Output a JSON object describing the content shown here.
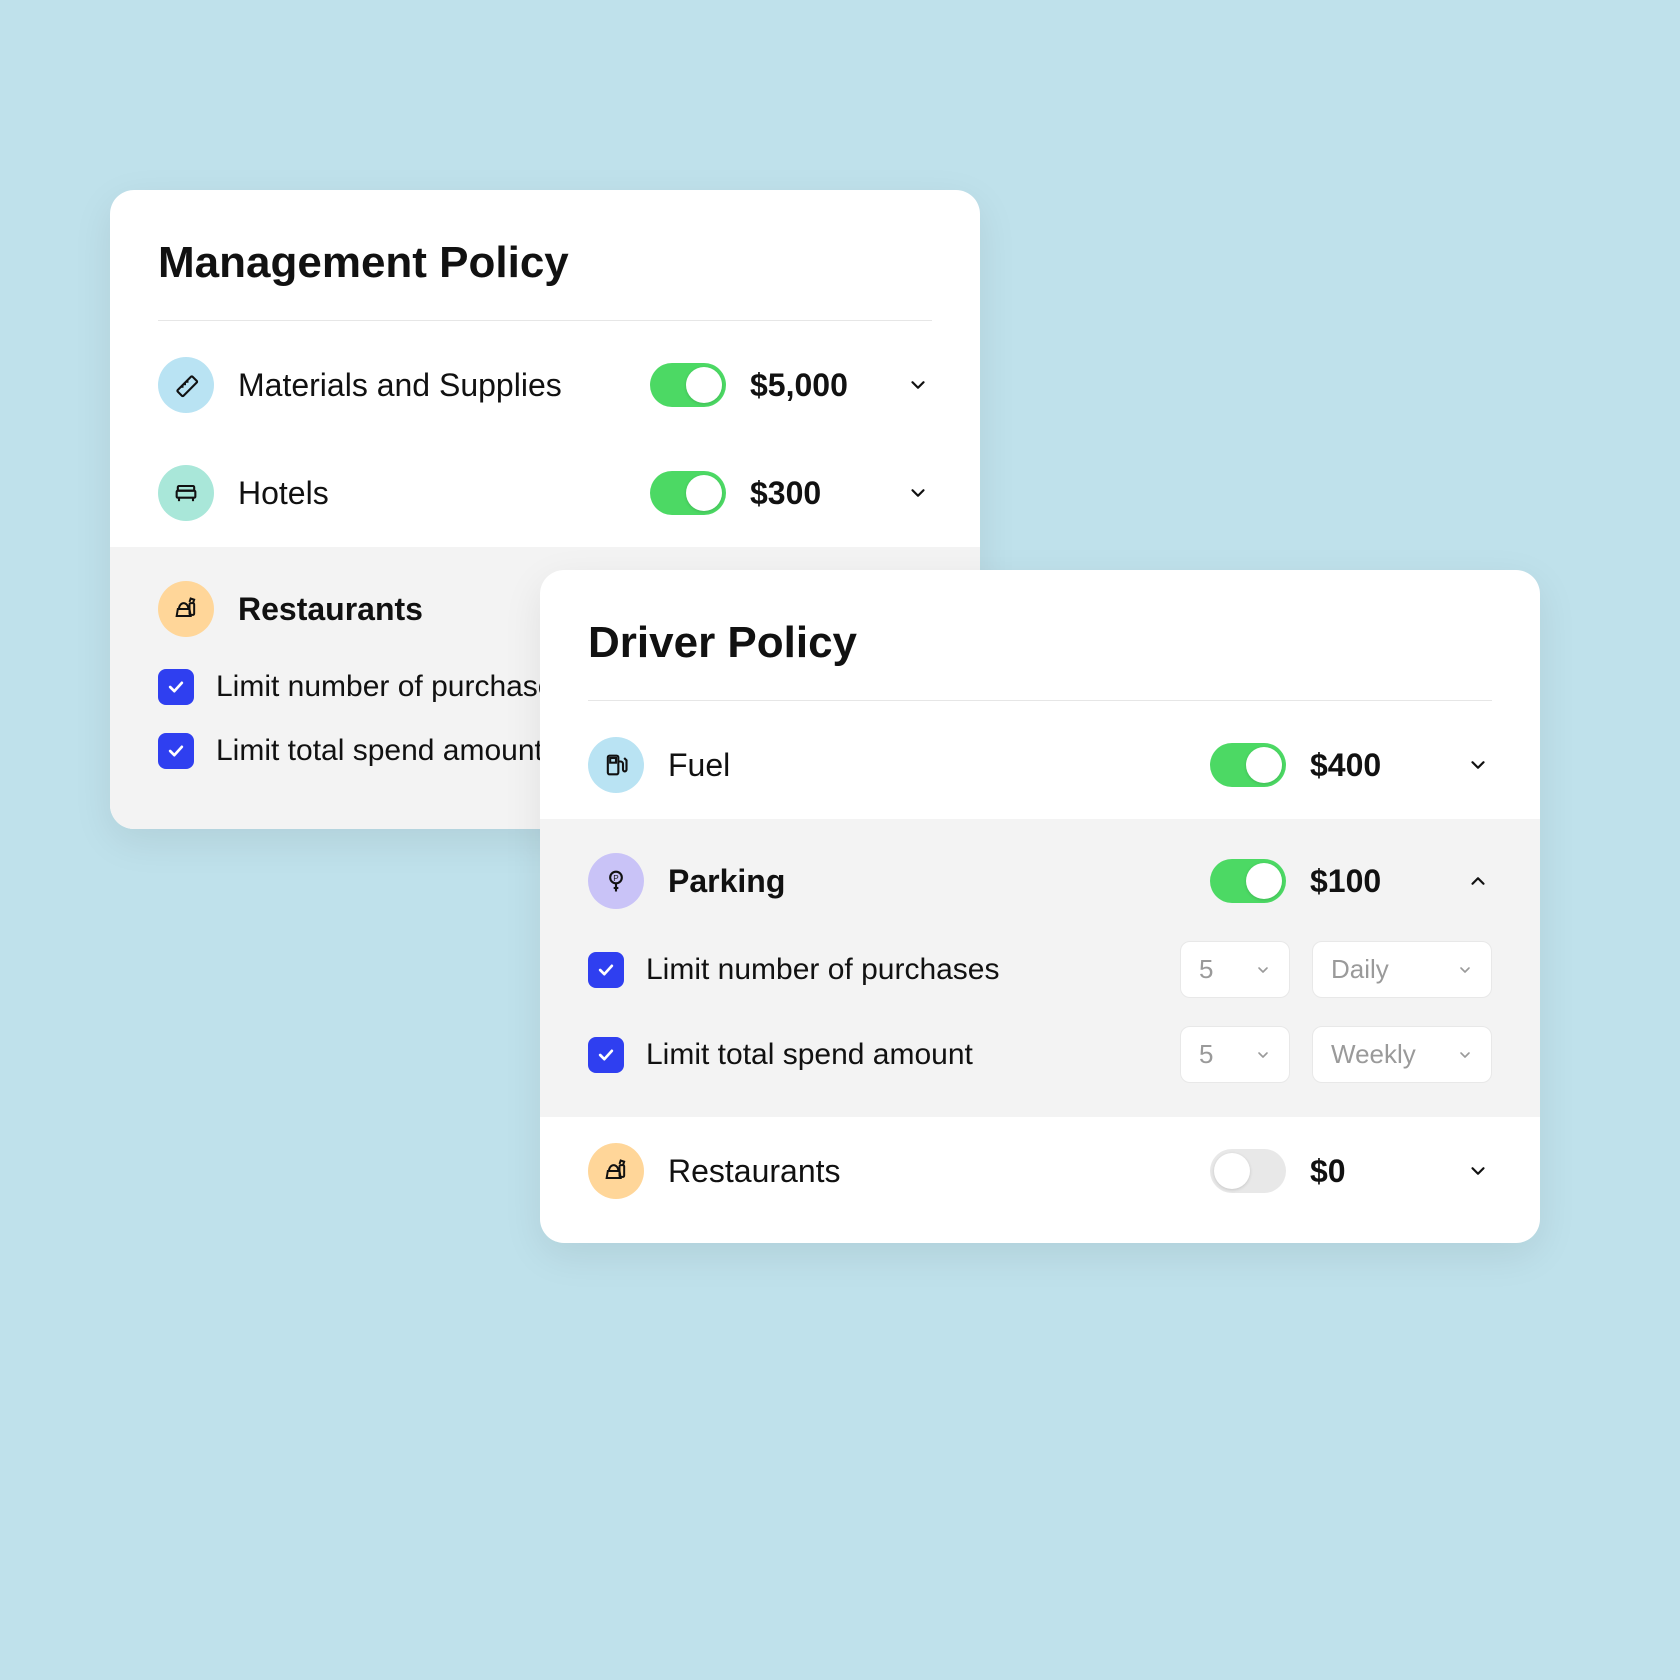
{
  "management": {
    "title": "Management Policy",
    "items": {
      "materials": {
        "label": "Materials and Supplies",
        "amount": "$5,000"
      },
      "hotels": {
        "label": "Hotels",
        "amount": "$300"
      },
      "restaurants": {
        "label": "Restaurants"
      }
    },
    "sub": {
      "limit_purchases": "Limit number of purchases",
      "limit_spend": "Limit total spend amount"
    }
  },
  "driver": {
    "title": "Driver Policy",
    "items": {
      "fuel": {
        "label": "Fuel",
        "amount": "$400"
      },
      "parking": {
        "label": "Parking",
        "amount": "$100"
      },
      "restaurants": {
        "label": "Restaurants",
        "amount": "$0"
      }
    },
    "sub": {
      "limit_purchases": "Limit number of purchases",
      "limit_spend": "Limit total spend amount",
      "sel_purchases_count": "5",
      "sel_purchases_period": "Daily",
      "sel_spend_count": "5",
      "sel_spend_period": "Weekly"
    }
  }
}
